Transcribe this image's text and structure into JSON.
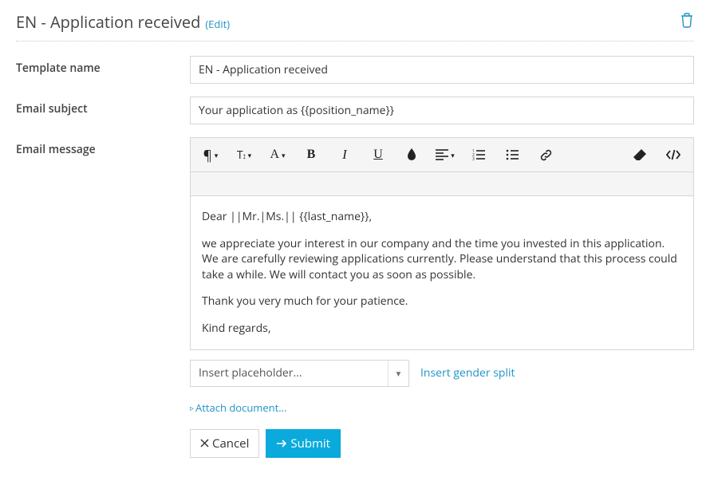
{
  "header": {
    "title": "EN - Application received",
    "edit_label": "(Edit)"
  },
  "form": {
    "template_name_label": "Template name",
    "template_name_value": "EN - Application received",
    "email_subject_label": "Email subject",
    "email_subject_value": "Your application as {{position_name}}",
    "email_message_label": "Email message"
  },
  "message": {
    "greeting": "Dear ||Mr.|Ms.|| {{last_name}},",
    "para1": "we appreciate your interest in our company and the time you invested in this application. We are carefully reviewing applications currently. Please understand that this process could take a while. We will contact you as soon as possible.",
    "para2": "Thank you very much for your patience.",
    "signoff": "Kind regards,"
  },
  "placeholder_select": "Insert placeholder...",
  "gender_split_link": "Insert gender split",
  "attach_link": "Attach document...",
  "buttons": {
    "cancel": "Cancel",
    "submit": "Submit"
  }
}
